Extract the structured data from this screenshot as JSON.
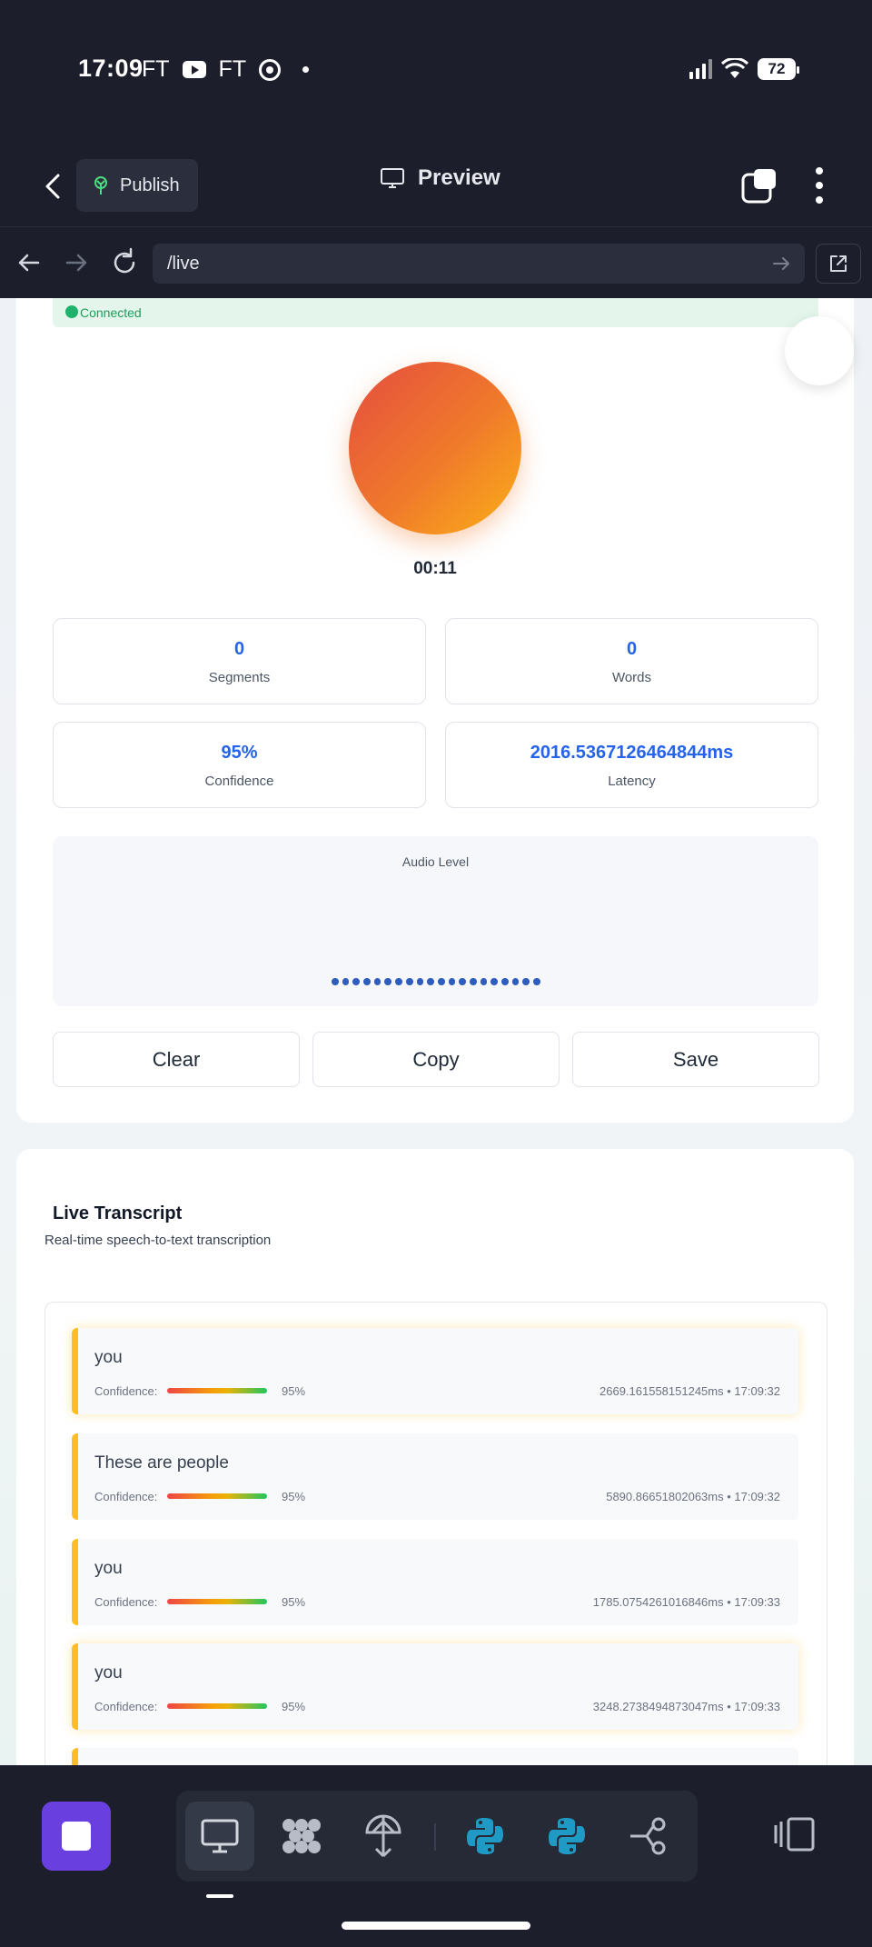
{
  "status_bar": {
    "time": "17:09",
    "app_indicators": [
      "FT",
      "FT"
    ],
    "battery": "72"
  },
  "header": {
    "publish_label": "Publish",
    "preview_label": "Preview"
  },
  "browser": {
    "url": "/live"
  },
  "recorder": {
    "connection_status": "Connected",
    "timer": "00:11",
    "stats": [
      {
        "value": "0",
        "label": "Segments"
      },
      {
        "value": "0",
        "label": "Words"
      },
      {
        "value": "95%",
        "label": "Confidence"
      },
      {
        "value": "2016.5367126464844ms",
        "label": "Latency"
      }
    ],
    "audio_level_label": "Audio Level",
    "actions": {
      "clear": "Clear",
      "copy": "Copy",
      "save": "Save"
    }
  },
  "transcript": {
    "title": "Live Transcript",
    "subtitle": "Real-time speech-to-text transcription",
    "confidence_label": "Confidence:",
    "segments": [
      {
        "text": "you",
        "confidence": "95%",
        "confidence_value": 0.95,
        "meta": "2669.161558151245ms • 17:09:32"
      },
      {
        "text": "These are people",
        "confidence": "95%",
        "confidence_value": 0.95,
        "meta": "5890.86651802063ms • 17:09:32"
      },
      {
        "text": "you",
        "confidence": "95%",
        "confidence_value": 0.95,
        "meta": "1785.0754261016846ms • 17:09:33"
      },
      {
        "text": "you",
        "confidence": "95%",
        "confidence_value": 0.95,
        "meta": "3248.2738494873047ms • 17:09:33"
      }
    ]
  },
  "toolbar": {
    "tools": [
      "monitor-icon",
      "grid-nodes-icon",
      "antenna-icon",
      "python-icon",
      "python-icon",
      "branch-icon"
    ]
  },
  "colors": {
    "accent": "#2563eb",
    "record_gradient_start": "#e44d3f",
    "record_gradient_end": "#fbb017",
    "segment_border": "#fbbf24",
    "stop_button": "#6a3fe0",
    "connected": "#1fb26b"
  }
}
